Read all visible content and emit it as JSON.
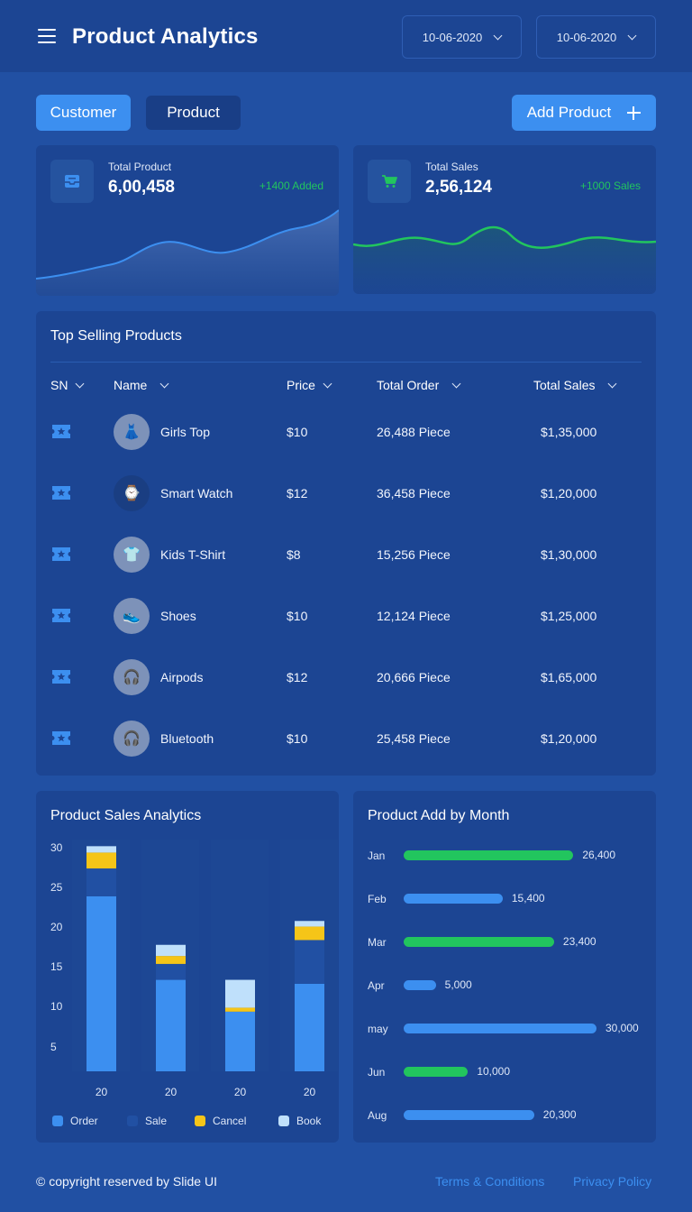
{
  "header": {
    "title": "Product Analytics",
    "date_from": "10-06-2020",
    "date_to": "10-06-2020"
  },
  "tabs": {
    "customer": "Customer",
    "product": "Product"
  },
  "actions": {
    "add_product": "Add Product"
  },
  "stats": {
    "total_product": {
      "label": "Total Product",
      "value": "6,00,458",
      "delta": "+1400 Added",
      "icon": "inbox-icon"
    },
    "total_sales": {
      "label": "Total Sales",
      "value": "2,56,124",
      "delta": "+1000 Sales",
      "icon": "cart-icon"
    }
  },
  "table": {
    "title": "Top Selling Products",
    "columns": [
      "SN",
      "Name",
      "Price",
      "Total Order",
      "Total Sales"
    ],
    "rows": [
      {
        "name": "Girls Top",
        "price": "$10",
        "order": "26,488 Piece",
        "sales": "$1,35,000",
        "avatar": "👗"
      },
      {
        "name": "Smart Watch",
        "price": "$12",
        "order": "36,458 Piece",
        "sales": "$1,20,000",
        "avatar": "⌚"
      },
      {
        "name": "Kids T-Shirt",
        "price": "$8",
        "order": "15,256 Piece",
        "sales": "$1,30,000",
        "avatar": "👕"
      },
      {
        "name": "Shoes",
        "price": "$10",
        "order": "12,124 Piece",
        "sales": "$1,25,000",
        "avatar": "👟"
      },
      {
        "name": "Airpods",
        "price": "$12",
        "order": "20,666 Piece",
        "sales": "$1,65,000",
        "avatar": "🎧"
      },
      {
        "name": "Bluetooth",
        "price": "$10",
        "order": "25,458 Piece",
        "sales": "$1,20,000",
        "avatar": "🎧"
      }
    ]
  },
  "sales_chart": {
    "title": "Product Sales Analytics",
    "legend": [
      "Order",
      "Sale",
      "Cancel",
      "Book"
    ]
  },
  "month_chart": {
    "title": "Product Add  by Month"
  },
  "colors": {
    "order": "#3c8ff0",
    "sale": "#2150a3",
    "cancel": "#f5c518",
    "book": "#bfe0fb",
    "green": "#22c55e",
    "blue": "#3c8ff0"
  },
  "chart_data": [
    {
      "type": "bar",
      "stacked": true,
      "title": "Product Sales Analytics",
      "categories": [
        "20",
        "20",
        "20",
        "20"
      ],
      "yticks": [
        30,
        25,
        20,
        15,
        10,
        5
      ],
      "ylim": [
        2,
        30
      ],
      "series": [
        {
          "name": "Order",
          "values": [
            22,
            11.5,
            7.5,
            11
          ]
        },
        {
          "name": "Sale",
          "values": [
            3.5,
            2,
            0,
            5.5
          ]
        },
        {
          "name": "Cancel",
          "values": [
            2,
            1,
            0.5,
            1.7
          ]
        },
        {
          "name": "Book",
          "values": [
            0.8,
            1.4,
            3.5,
            0.7
          ]
        }
      ]
    },
    {
      "type": "bar",
      "orientation": "horizontal",
      "title": "Product Add  by Month",
      "categories": [
        "Jan",
        "Feb",
        "Mar",
        "Apr",
        "may",
        "Jun",
        "Aug"
      ],
      "values": [
        26400,
        15400,
        23400,
        5000,
        30000,
        10000,
        20300
      ],
      "value_labels": [
        "26,400",
        "15,400",
        "23,400",
        "5,000",
        "30,000",
        "10,000",
        "20,300"
      ],
      "bar_colors": [
        "green",
        "blue",
        "green",
        "blue",
        "blue",
        "green",
        "blue"
      ],
      "xlim": [
        0,
        30000
      ]
    }
  ],
  "footer": {
    "copyright": "© copyright reserved by Slide UI",
    "terms": "Terms & Conditions",
    "privacy": "Privacy Policy"
  }
}
